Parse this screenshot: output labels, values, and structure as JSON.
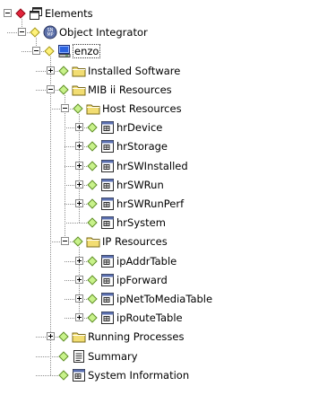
{
  "colors": {
    "tree_line": "#8f8f8f",
    "status_red": "#e2233b",
    "status_yellow": "#fff27a",
    "status_green": "#c8f28a",
    "folder_yellow": "#f2dd72"
  },
  "tree": [
    {
      "id": "elements",
      "label": "Elements",
      "level": 0,
      "toggle": "minus",
      "status": "red",
      "icon": "window-icon"
    },
    {
      "id": "object-integrator",
      "label": "Object Integrator",
      "level": 1,
      "toggle": "minus",
      "status": "yellow",
      "icon": "snmp-icon"
    },
    {
      "id": "enzo",
      "label": "enzo",
      "level": 2,
      "toggle": "minus",
      "status": "yellow",
      "icon": "computer-icon",
      "selected": true
    },
    {
      "id": "installed-software",
      "label": "Installed Software",
      "level": 3,
      "toggle": "plus",
      "status": "green",
      "icon": "folder-icon"
    },
    {
      "id": "mib-ii-resources",
      "label": "MIB ii Resources",
      "level": 3,
      "toggle": "minus",
      "status": "green",
      "icon": "folder-icon"
    },
    {
      "id": "host-resources",
      "label": "Host Resources",
      "level": 4,
      "toggle": "minus",
      "status": "green",
      "icon": "folder-icon"
    },
    {
      "id": "hrdevice",
      "label": "hrDevice",
      "level": 5,
      "toggle": "plus",
      "status": "green",
      "icon": "table-icon"
    },
    {
      "id": "hrstorage",
      "label": "hrStorage",
      "level": 5,
      "toggle": "plus",
      "status": "green",
      "icon": "table-icon"
    },
    {
      "id": "hrswinstalled",
      "label": "hrSWInstalled",
      "level": 5,
      "toggle": "plus",
      "status": "green",
      "icon": "table-icon"
    },
    {
      "id": "hrswrun",
      "label": "hrSWRun",
      "level": 5,
      "toggle": "plus",
      "status": "green",
      "icon": "table-icon"
    },
    {
      "id": "hrswrunperf",
      "label": "hrSWRunPerf",
      "level": 5,
      "toggle": "plus",
      "status": "green",
      "icon": "table-icon"
    },
    {
      "id": "hrsystem",
      "label": "hrSystem",
      "level": 5,
      "toggle": "none",
      "status": "green",
      "icon": "table-icon"
    },
    {
      "id": "ip-resources",
      "label": "IP Resources",
      "level": 4,
      "toggle": "minus",
      "status": "green",
      "icon": "folder-icon"
    },
    {
      "id": "ipaddrtable",
      "label": "ipAddrTable",
      "level": 5,
      "toggle": "plus",
      "status": "green",
      "icon": "table-icon"
    },
    {
      "id": "ipforward",
      "label": "ipForward",
      "level": 5,
      "toggle": "plus",
      "status": "green",
      "icon": "table-icon"
    },
    {
      "id": "ipnettomediatable",
      "label": "ipNetToMediaTable",
      "level": 5,
      "toggle": "plus",
      "status": "green",
      "icon": "table-icon"
    },
    {
      "id": "iproutetable",
      "label": "ipRouteTable",
      "level": 5,
      "toggle": "plus",
      "status": "green",
      "icon": "table-icon"
    },
    {
      "id": "running-processes",
      "label": "Running Processes",
      "level": 3,
      "toggle": "plus",
      "status": "green",
      "icon": "folder-icon"
    },
    {
      "id": "summary",
      "label": "Summary",
      "level": 3,
      "toggle": "none",
      "status": "green",
      "icon": "document-icon"
    },
    {
      "id": "system-information",
      "label": "System Information",
      "level": 3,
      "toggle": "none",
      "status": "green",
      "icon": "table-icon"
    }
  ]
}
